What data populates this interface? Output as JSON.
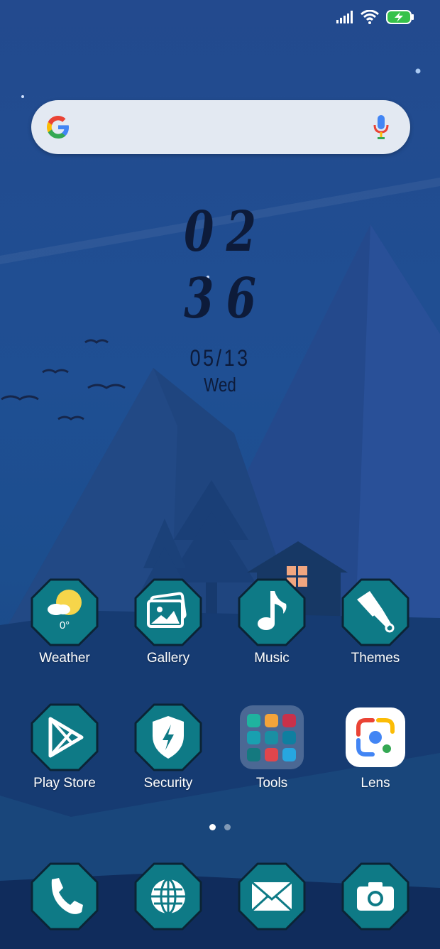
{
  "status_bar": {
    "signal_icon": "cellular-signal-icon",
    "wifi_icon": "wifi-icon",
    "battery_icon": "battery-charging-icon"
  },
  "search": {
    "logo_icon": "google-logo-icon",
    "mic_icon": "mic-icon"
  },
  "clock": {
    "hour": "02",
    "minute": "36",
    "date": "05/13",
    "weekday": "Wed"
  },
  "apps": [
    {
      "label": "Weather",
      "icon": "weather-icon",
      "temp": "0°"
    },
    {
      "label": "Gallery",
      "icon": "gallery-icon"
    },
    {
      "label": "Music",
      "icon": "music-note-icon"
    },
    {
      "label": "Themes",
      "icon": "paintbrush-icon"
    },
    {
      "label": "Play Store",
      "icon": "play-store-icon"
    },
    {
      "label": "Security",
      "icon": "security-shield-icon"
    },
    {
      "label": "Tools",
      "icon": "folder-icon"
    },
    {
      "label": "Lens",
      "icon": "lens-icon"
    }
  ],
  "dock": [
    {
      "icon": "phone-icon"
    },
    {
      "icon": "browser-globe-icon"
    },
    {
      "icon": "mail-icon"
    },
    {
      "icon": "camera-icon"
    }
  ],
  "pages": {
    "count": 2,
    "active": 1
  },
  "colors": {
    "tile": "#0e7a86",
    "tile_border": "#0b2435",
    "background": "#1f4f93",
    "clock_text": "#0d1b3a"
  }
}
